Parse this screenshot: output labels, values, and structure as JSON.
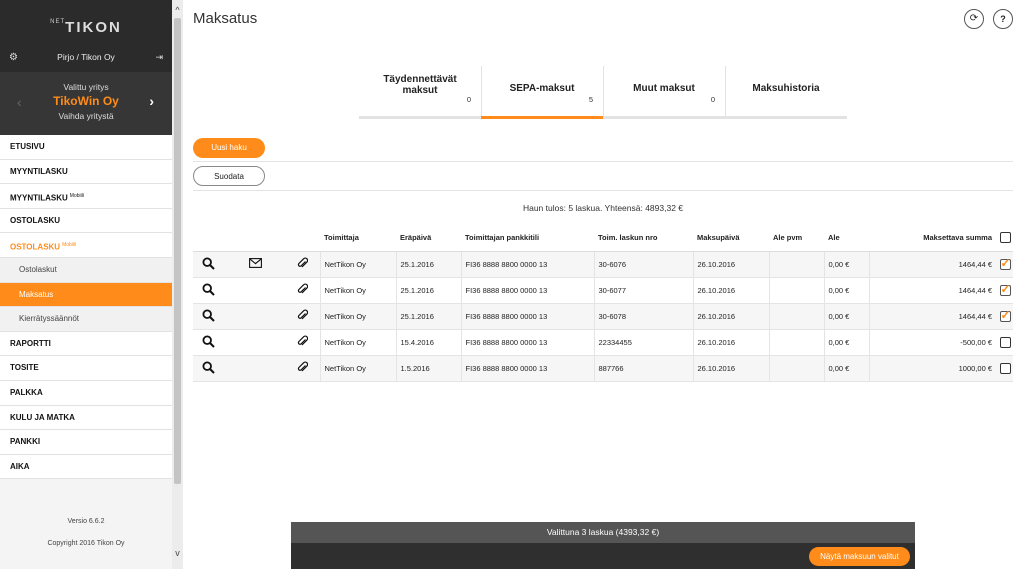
{
  "sidebar": {
    "logo_net": "NET",
    "logo_tikon": "TIKON",
    "user": "Pirjo / Tikon Oy",
    "company_label": "Valittu yritys",
    "company_name": "TikoWin Oy",
    "switch_company": "Vaihda yritystä",
    "items": [
      {
        "label": "ETUSIVU"
      },
      {
        "label": "MYYNTILASKU"
      },
      {
        "label": "MYYNTILASKU",
        "badge": "Mobiili"
      },
      {
        "label": "OSTOLASKU"
      },
      {
        "label": "OSTOLASKU",
        "badge": "Mobiili"
      },
      {
        "label": "Ostolaskut"
      },
      {
        "label": "Maksatus"
      },
      {
        "label": "Kierrätyssäännöt"
      },
      {
        "label": "RAPORTTI"
      },
      {
        "label": "TOSITE"
      },
      {
        "label": "PALKKA"
      },
      {
        "label": "KULU JA MATKA"
      },
      {
        "label": "PANKKI"
      },
      {
        "label": "AIKA"
      }
    ],
    "version": "Versio 6.6.2",
    "copyright": "Copyright 2016 Tikon Oy"
  },
  "page": {
    "title": "Maksatus",
    "help_label": "?"
  },
  "tabs": [
    {
      "label_line1": "Täydennettävät",
      "label_line2": "maksut",
      "count": "0"
    },
    {
      "label": "SEPA-maksut",
      "count": "5"
    },
    {
      "label": "Muut maksut",
      "count": "0"
    },
    {
      "label": "Maksuhistoria"
    }
  ],
  "actions": {
    "new_search": "Uusi haku",
    "filter": "Suodata"
  },
  "result_text": "Haun tulos: 5 laskua. Yhteensä: 4893,32 €",
  "table": {
    "headers": [
      "Toimittaja",
      "Eräpäivä",
      "Toimittajan pankkitili",
      "Toim. laskun nro",
      "Maksupäivä",
      "Ale pvm",
      "Ale",
      "Maksettava summa"
    ],
    "rows": [
      {
        "supplier": "NetTikon Oy",
        "due": "25.1.2016",
        "account": "FI36 8888 8800 0000 13",
        "invoice": "30-6076",
        "paydate": "26.10.2016",
        "disc_date": "",
        "disc": "0,00 €",
        "amount": "1464,44 €",
        "checked": true,
        "mail": true
      },
      {
        "supplier": "NetTikon Oy",
        "due": "25.1.2016",
        "account": "FI36 8888 8800 0000 13",
        "invoice": "30-6077",
        "paydate": "26.10.2016",
        "disc_date": "",
        "disc": "0,00 €",
        "amount": "1464,44 €",
        "checked": true,
        "mail": false
      },
      {
        "supplier": "NetTikon Oy",
        "due": "25.1.2016",
        "account": "FI36 8888 8800 0000 13",
        "invoice": "30-6078",
        "paydate": "26.10.2016",
        "disc_date": "",
        "disc": "0,00 €",
        "amount": "1464,44 €",
        "checked": true,
        "mail": false
      },
      {
        "supplier": "NetTikon Oy",
        "due": "15.4.2016",
        "account": "FI36 8888 8800 0000 13",
        "invoice": "22334455",
        "paydate": "26.10.2016",
        "disc_date": "",
        "disc": "0,00 €",
        "amount": "-500,00 €",
        "checked": false,
        "mail": false
      },
      {
        "supplier": "NetTikon Oy",
        "due": "1.5.2016",
        "account": "FI36 8888 8800 0000 13",
        "invoice": "887766",
        "paydate": "26.10.2016",
        "disc_date": "",
        "disc": "0,00 €",
        "amount": "1000,00 €",
        "checked": false,
        "mail": false
      }
    ]
  },
  "bottom": {
    "summary": "Valittuna 3 laskua (4393,32 €)",
    "show_selected": "Näytä maksuun valitut"
  },
  "colors": {
    "accent": "#ff8c1a",
    "sidebar_dark": "#2b2b2b"
  },
  "icons": [
    "gear-icon",
    "logout-icon",
    "chevron-left-icon",
    "chevron-right-icon",
    "refresh-icon",
    "magnifier-icon",
    "envelope-icon",
    "paperclip-icon"
  ]
}
